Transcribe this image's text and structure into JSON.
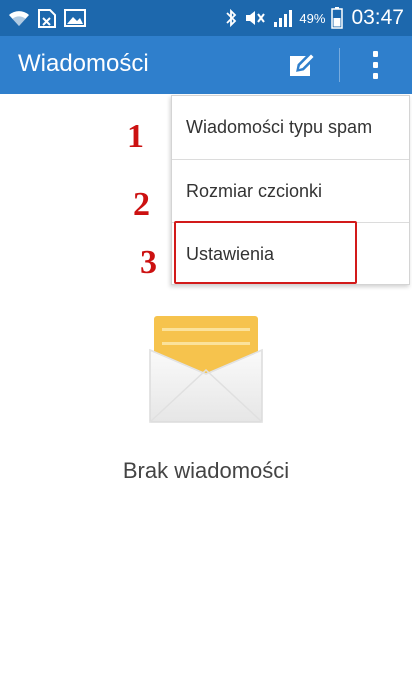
{
  "status_bar": {
    "battery_percent": "49%",
    "time": "03:47",
    "icons": [
      "wifi-icon",
      "data-saver-icon",
      "image-icon",
      "bluetooth-icon",
      "mute-icon",
      "signal-icon",
      "battery-icon"
    ]
  },
  "action_bar": {
    "title": "Wiadomości",
    "icons": [
      "compose-icon",
      "more-vert-icon"
    ]
  },
  "menu": {
    "items": [
      {
        "label": "Wiadomości typu spam"
      },
      {
        "label": "Rozmiar czcionki"
      },
      {
        "label": "Ustawienia"
      }
    ]
  },
  "annotations": {
    "step1": "1",
    "step2": "2",
    "step3": "3"
  },
  "empty_state": {
    "message": "Brak wiadomości",
    "icon": "envelope-icon"
  },
  "colors": {
    "status_bar": "#1d68ad",
    "action_bar": "#2f7fcc",
    "annotation_red": "#cc1111"
  }
}
